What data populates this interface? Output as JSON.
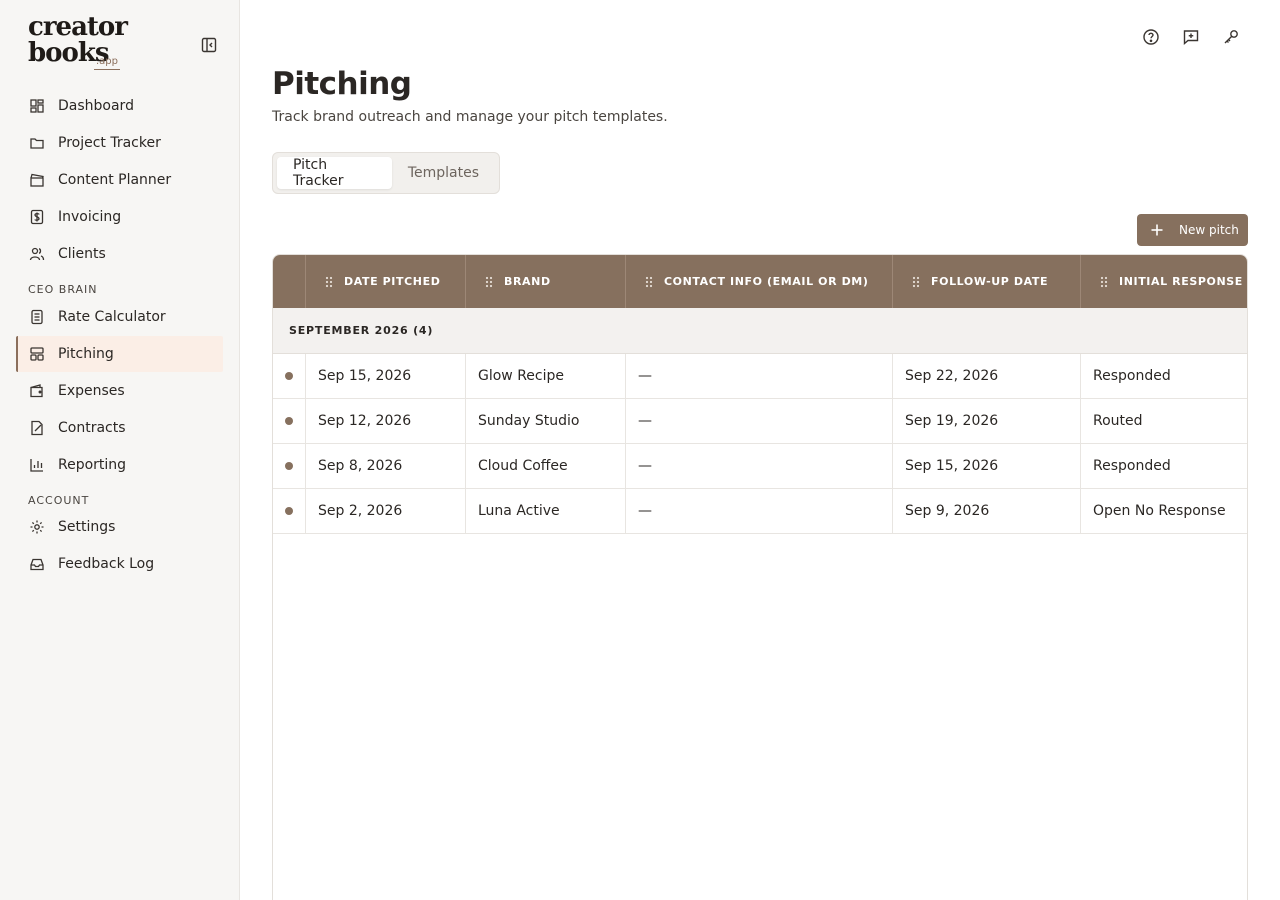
{
  "app": {
    "logo_line1": "creator",
    "logo_line2": "books",
    "logo_suffix": ".app"
  },
  "sidebar": {
    "items": [
      {
        "label": "Dashboard",
        "icon": "grid-icon"
      },
      {
        "label": "Project Tracker",
        "icon": "folder-icon"
      },
      {
        "label": "Content Planner",
        "icon": "clapper-icon"
      },
      {
        "label": "Invoicing",
        "icon": "dollar-icon"
      },
      {
        "label": "Clients",
        "icon": "users-icon"
      }
    ],
    "section_ceo": "CEO BRAIN",
    "ceo_items": [
      {
        "label": "Rate Calculator",
        "icon": "calculator-icon"
      },
      {
        "label": "Pitching",
        "icon": "layout-icon",
        "active": true
      },
      {
        "label": "Expenses",
        "icon": "wallet-icon"
      },
      {
        "label": "Contracts",
        "icon": "contract-icon"
      },
      {
        "label": "Reporting",
        "icon": "bar-chart-icon"
      }
    ],
    "section_account": "ACCOUNT",
    "account_items": [
      {
        "label": "Settings",
        "icon": "gear-icon"
      },
      {
        "label": "Feedback Log",
        "icon": "inbox-icon"
      }
    ]
  },
  "header": {
    "title": "Pitching",
    "subtitle": "Track brand outreach and manage your pitch templates."
  },
  "tabs": [
    {
      "label": "Pitch Tracker",
      "active": true
    },
    {
      "label": "Templates",
      "active": false
    }
  ],
  "actions": {
    "new_pitch": "New pitch"
  },
  "table": {
    "columns": [
      "DATE PITCHED",
      "BRAND",
      "CONTACT INFO (EMAIL OR DM)",
      "FOLLOW-UP DATE",
      "INITIAL RESPONSE"
    ],
    "group_label": "SEPTEMBER 2026 (4)",
    "rows": [
      {
        "date": "Sep 15, 2026",
        "brand": "Glow Recipe",
        "contact": "—",
        "followup": "Sep 22, 2026",
        "response": "Responded"
      },
      {
        "date": "Sep 12, 2026",
        "brand": "Sunday Studio",
        "contact": "—",
        "followup": "Sep 19, 2026",
        "response": "Routed"
      },
      {
        "date": "Sep 8, 2026",
        "brand": "Cloud Coffee",
        "contact": "—",
        "followup": "Sep 15, 2026",
        "response": "Responded"
      },
      {
        "date": "Sep 2, 2026",
        "brand": "Luna Active",
        "contact": "—",
        "followup": "Sep 9, 2026",
        "response": "Open No Response"
      }
    ]
  },
  "colors": {
    "accent": "#86705e",
    "active_bg": "#fbeee6",
    "sidebar_bg": "#f7f6f4"
  }
}
